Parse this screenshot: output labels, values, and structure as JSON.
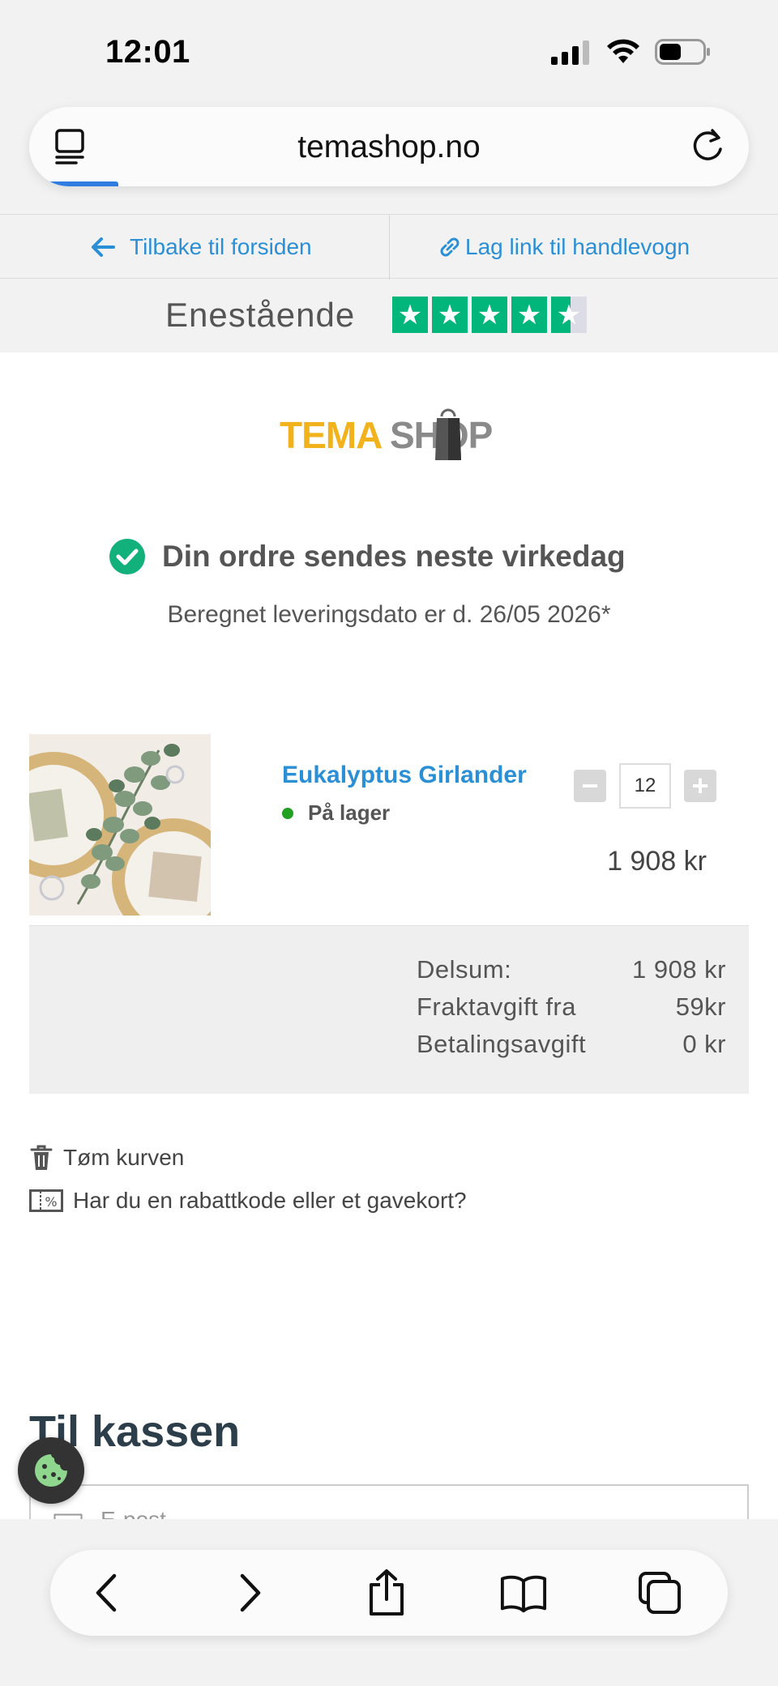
{
  "status": {
    "time": "12:01"
  },
  "browser": {
    "url": "temashop.no",
    "progress_fraction": 0.12
  },
  "nav": {
    "back_label": "Tilbake til forsiden",
    "cart_link_label": "Lag link til handlevogn"
  },
  "rating": {
    "label": "Enestående",
    "stars": 4.5,
    "star_color": "#00b67a"
  },
  "logo": {
    "tema": "TEMA",
    "shop": "SHOP"
  },
  "shipping": {
    "headline": "Din ordre sendes neste virkedag",
    "delivery": "Beregnet leveringsdato er d. 26/05 2026*"
  },
  "cart": {
    "item": {
      "name": "Eukalyptus Girlander",
      "stock": "På lager",
      "quantity": "12",
      "price": "1 908 kr"
    },
    "totals": [
      {
        "label": "Delsum:",
        "value": "1 908 kr"
      },
      {
        "label": "Fraktavgift fra",
        "value": "59kr"
      },
      {
        "label": "Betalingsavgift",
        "value": "0 kr"
      }
    ],
    "clear_label": "Tøm kurven",
    "coupon_label": "Har du en rabattkode eller et gavekort?"
  },
  "checkout": {
    "title": "Til kassen",
    "field_placeholder": "E-post"
  },
  "colors": {
    "link": "#2b8fd6",
    "brand_yellow": "#f2b21b",
    "success": "#12b07a"
  }
}
